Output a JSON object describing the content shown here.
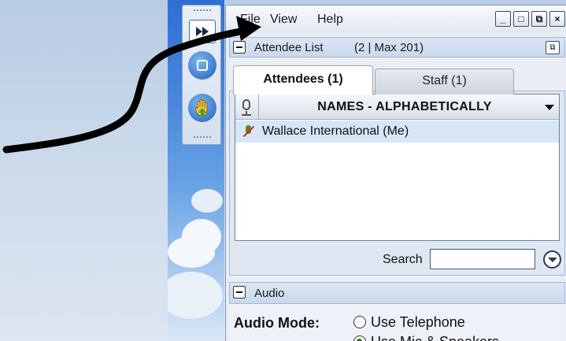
{
  "menu": {
    "file": "File",
    "view": "View",
    "help": "Help"
  },
  "window_controls": {
    "minimize_icon": "minimize-icon",
    "maximize_icon": "maximize-icon",
    "restore_icon": "restore-icon",
    "close_icon": "close-icon"
  },
  "attendee_panel": {
    "title": "Attendee List",
    "count": "(2 | Max 201)"
  },
  "tabs": [
    {
      "label": "Attendees (1)",
      "active": true
    },
    {
      "label": "Staff (1)",
      "active": false
    }
  ],
  "list": {
    "header": "NAMES - ALPHABETICALLY",
    "rows": [
      {
        "name": "Wallace International (Me)",
        "mic": "muted"
      }
    ]
  },
  "search": {
    "label": "Search",
    "value": ""
  },
  "audio_panel": {
    "title": "Audio",
    "mode_label": "Audio Mode:",
    "options": [
      {
        "label": "Use Telephone",
        "selected": false
      },
      {
        "label": "Use Mic & Speakers",
        "selected": true
      }
    ]
  },
  "colors": {
    "accent": "#1f60b8",
    "panel_header": "#c9d8ec",
    "row_highlight": "#d6e6f7"
  }
}
